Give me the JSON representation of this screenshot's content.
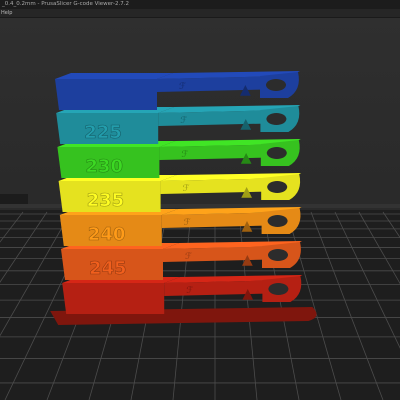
{
  "window": {
    "title": "_0.4_0.2mm - PrusaSlicer G-code Viewer-2.7.2"
  },
  "menu": {
    "items": [
      {
        "label": "Help"
      }
    ]
  },
  "viewport": {
    "content": "3D G-code preview of a multi-level temperature tower",
    "background_color": "#2b2b2b",
    "bed_color": "#202020",
    "grid_color": "#4a4a4a"
  },
  "model": {
    "layers": [
      {
        "label": "",
        "color": "#1d3f9e"
      },
      {
        "label": "225",
        "color": "#1f8c9a"
      },
      {
        "label": "230",
        "color": "#36c21f"
      },
      {
        "label": "235",
        "color": "#e5e21f"
      },
      {
        "label": "240",
        "color": "#e58a16"
      },
      {
        "label": "245",
        "color": "#d7551a"
      },
      {
        "label": "",
        "color": "#b52013"
      }
    ],
    "logo_text": "ℱ",
    "overhang_marker": "▲"
  }
}
